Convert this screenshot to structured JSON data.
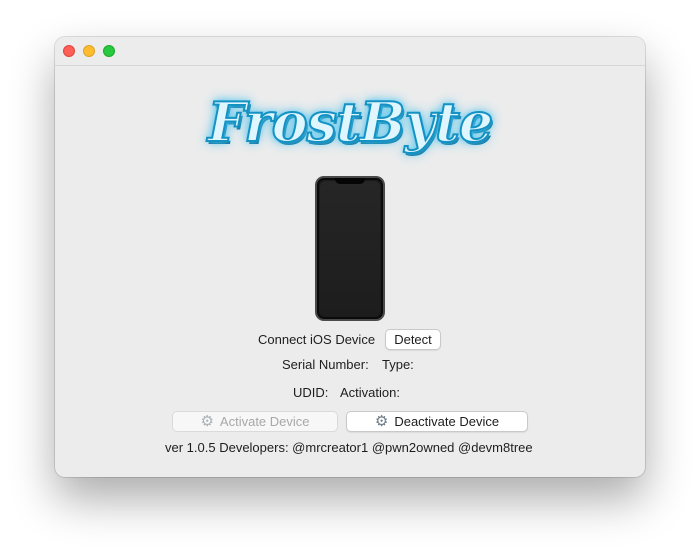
{
  "window": {
    "controls": [
      "close",
      "minimize",
      "zoom"
    ]
  },
  "logo": {
    "text": "FrostByte"
  },
  "device": {
    "icon": "iphone-icon"
  },
  "connect": {
    "label": "Connect iOS Device",
    "detect_button": "Detect"
  },
  "info": {
    "serial_label": "Serial Number:",
    "type_label": "Type:",
    "udid_label": "UDID:",
    "activation_label": "Activation:"
  },
  "actions": {
    "activate_label": "Activate Device",
    "activate_enabled": false,
    "deactivate_label": "Deactivate Device",
    "deactivate_enabled": true,
    "button_icon": "gear-icon"
  },
  "footer": {
    "text": "ver 1.0.5 Developers: @mrcreator1 @pwn2owned @devm8tree"
  },
  "colors": {
    "close": "#fe5f57",
    "minimize": "#febc2e",
    "zoom": "#28c840",
    "logo_glow": "#2bb6ea"
  }
}
